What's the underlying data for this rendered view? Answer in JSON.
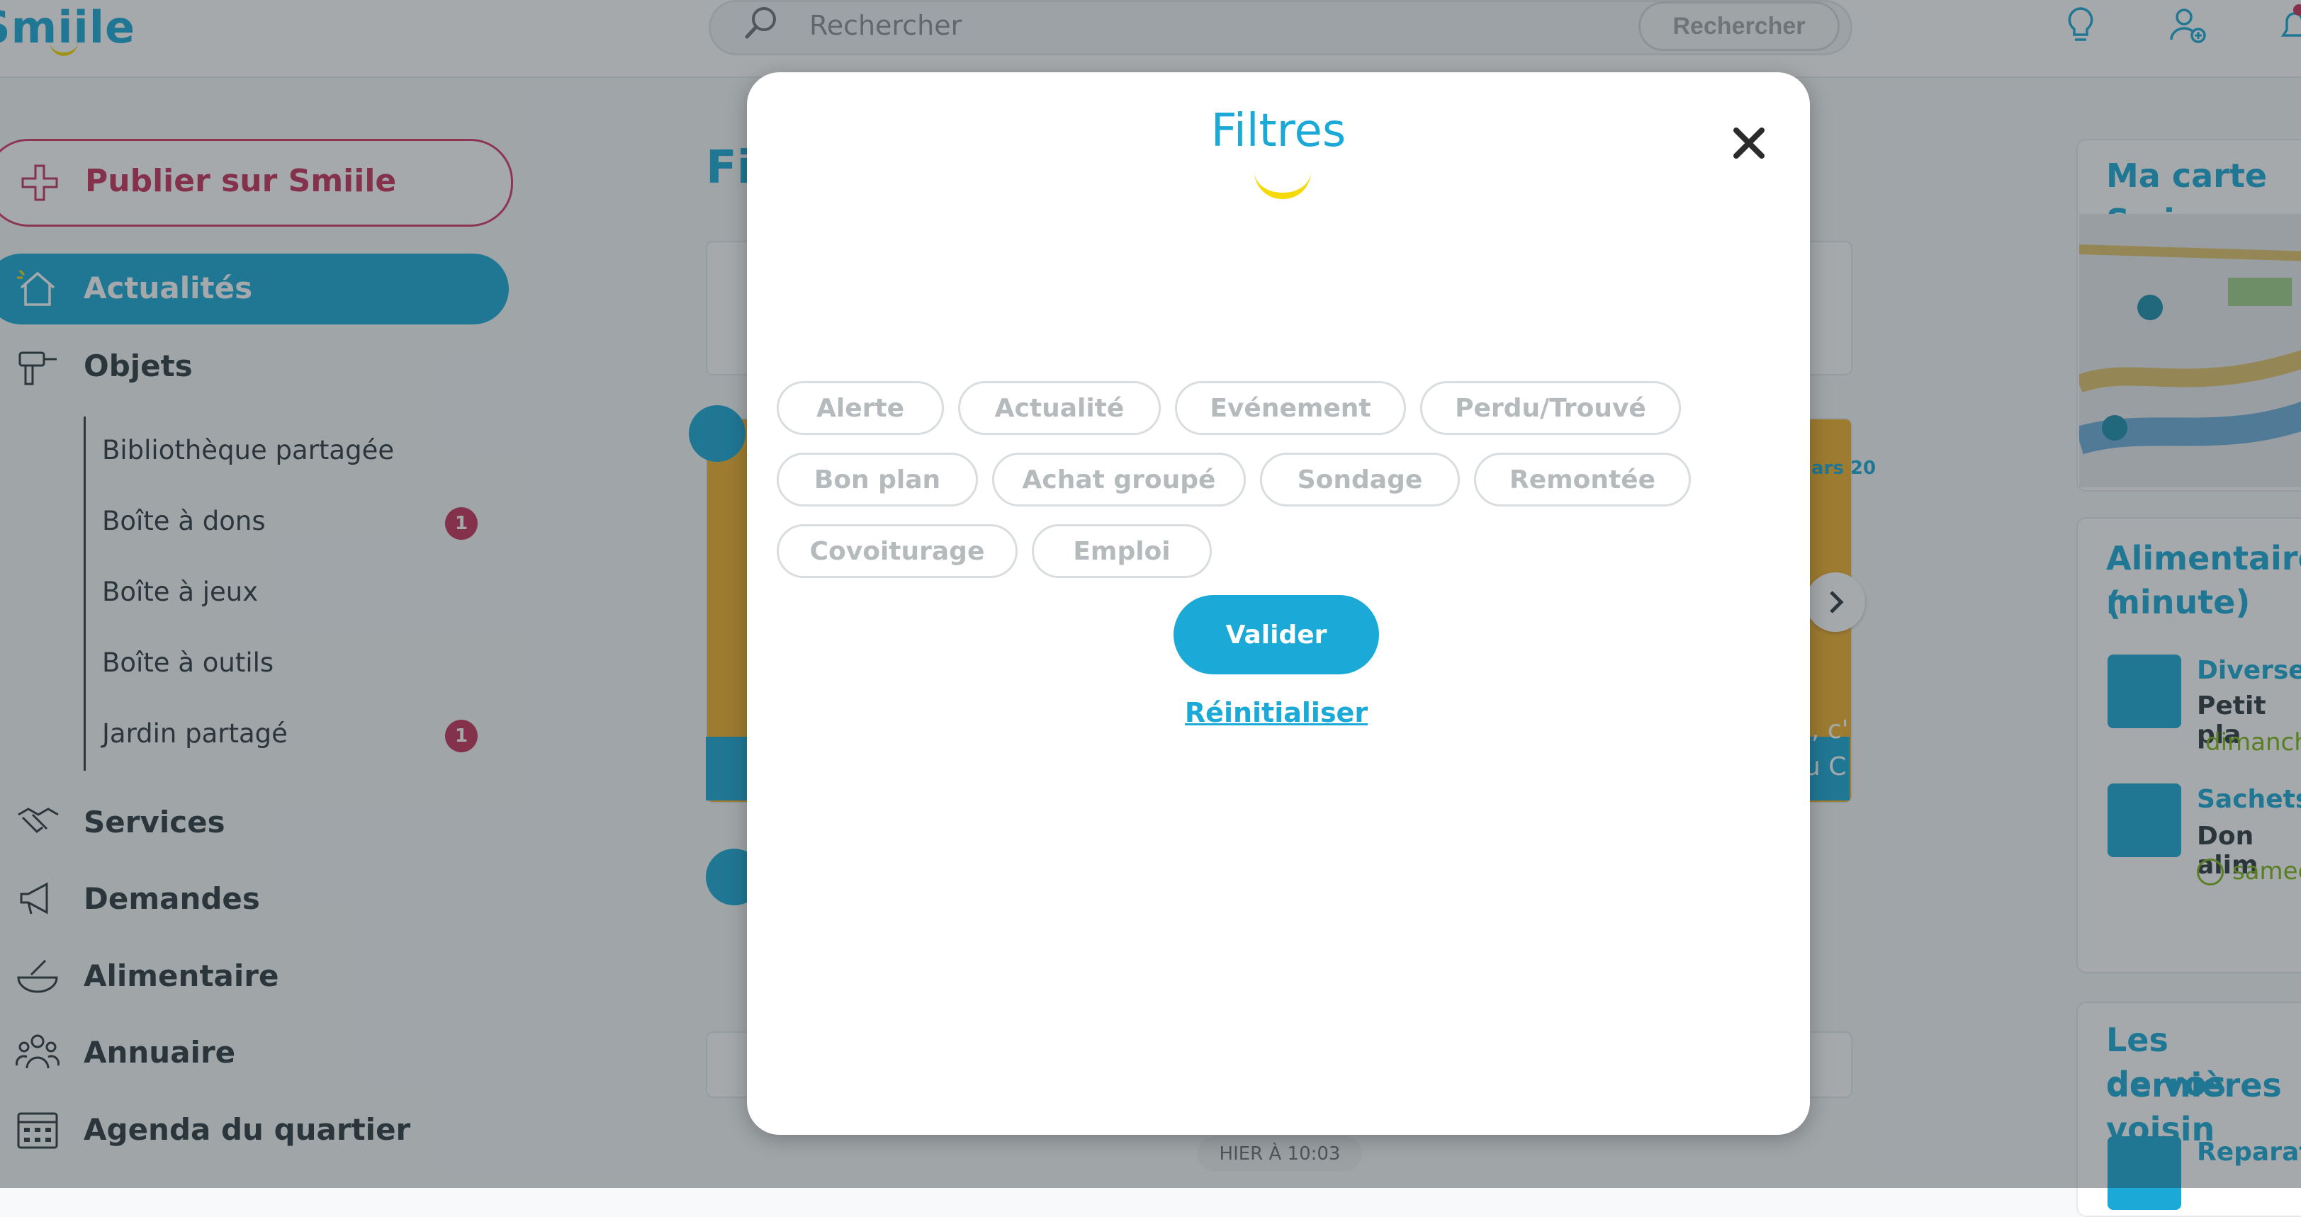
{
  "header": {
    "logo_text": "Smiile",
    "search_placeholder": "Rechercher",
    "search_button": "Rechercher",
    "icons": [
      "lightbulb-icon",
      "add-user-icon",
      "bell-icon"
    ]
  },
  "sidebar": {
    "publish_label": "Publier sur Smiile",
    "items": [
      {
        "label": "Actualités",
        "icon": "home-icon",
        "active": true
      },
      {
        "label": "Objets",
        "icon": "drill-icon"
      },
      {
        "label": "Services",
        "icon": "handshake-icon"
      },
      {
        "label": "Demandes",
        "icon": "megaphone-icon"
      },
      {
        "label": "Alimentaire",
        "icon": "food-bowl-icon"
      },
      {
        "label": "Annuaire",
        "icon": "people-icon"
      },
      {
        "label": "Agenda du quartier",
        "icon": "calendar-icon"
      }
    ],
    "subitems": [
      {
        "label": "Bibliothèque partagée",
        "badge": ""
      },
      {
        "label": "Boîte à dons",
        "badge": "1"
      },
      {
        "label": "Boîte à jeux",
        "badge": ""
      },
      {
        "label": "Boîte à outils",
        "badge": ""
      },
      {
        "label": "Jardin partagé",
        "badge": "1"
      }
    ]
  },
  "main": {
    "title_fragment": "Fi",
    "timestamp": "HIER À 10:03",
    "card_fragment_date": "ars 20",
    "card_fragment_text1": "i, c'",
    "card_fragment_text2": "u C"
  },
  "right": {
    "map_title": "Ma carte Smi",
    "food_title": "Alimentaire (",
    "food_title_2": "minute)",
    "food_items": [
      {
        "title": "Diverses",
        "subtitle": "Petit pla",
        "date": "dimanch"
      },
      {
        "title": "Sachets",
        "subtitle": "Don alim",
        "date": "samed"
      }
    ],
    "latest_title": "Les dernières",
    "latest_title_2": "de vos voisin",
    "latest_item": "Reparati"
  },
  "modal": {
    "title": "Filtres",
    "chips": [
      "Alerte",
      "Actualité",
      "Evénement",
      "Perdu/Trouvé",
      "Bon plan",
      "Achat groupé",
      "Sondage",
      "Remontée",
      "Covoiturage",
      "Emploi"
    ],
    "validate_label": "Valider",
    "reset_label": "Réinitialiser"
  },
  "colors": {
    "accent": "#1ba9d8",
    "brand_pink": "#c7325c",
    "smile_yellow": "#f5d90a"
  }
}
